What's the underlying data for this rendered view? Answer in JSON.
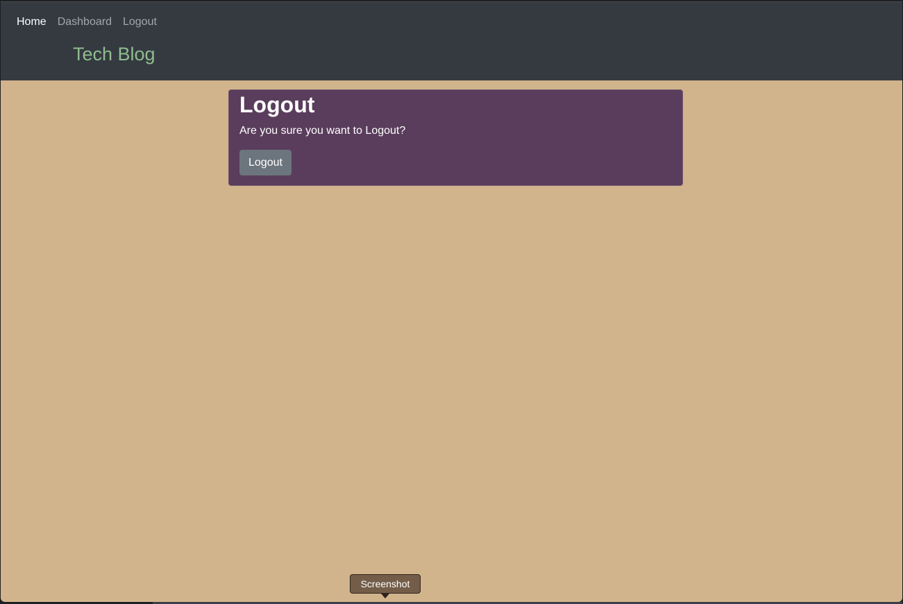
{
  "nav": {
    "links": [
      {
        "label": "Home",
        "active": true
      },
      {
        "label": "Dashboard",
        "active": false
      },
      {
        "label": "Logout",
        "active": false
      }
    ],
    "brand": "Tech Blog"
  },
  "logout_card": {
    "title": "Logout",
    "text": "Are you sure you want to Logout?",
    "button_label": "Logout"
  },
  "tooltip": {
    "label": "Screenshot"
  },
  "colors": {
    "navbar_bg": "#343a40",
    "page_bg": "#d2b48c",
    "brand": "#8fbc8f",
    "card_bg": "#5a3d5c",
    "button_bg": "#6c757d"
  }
}
